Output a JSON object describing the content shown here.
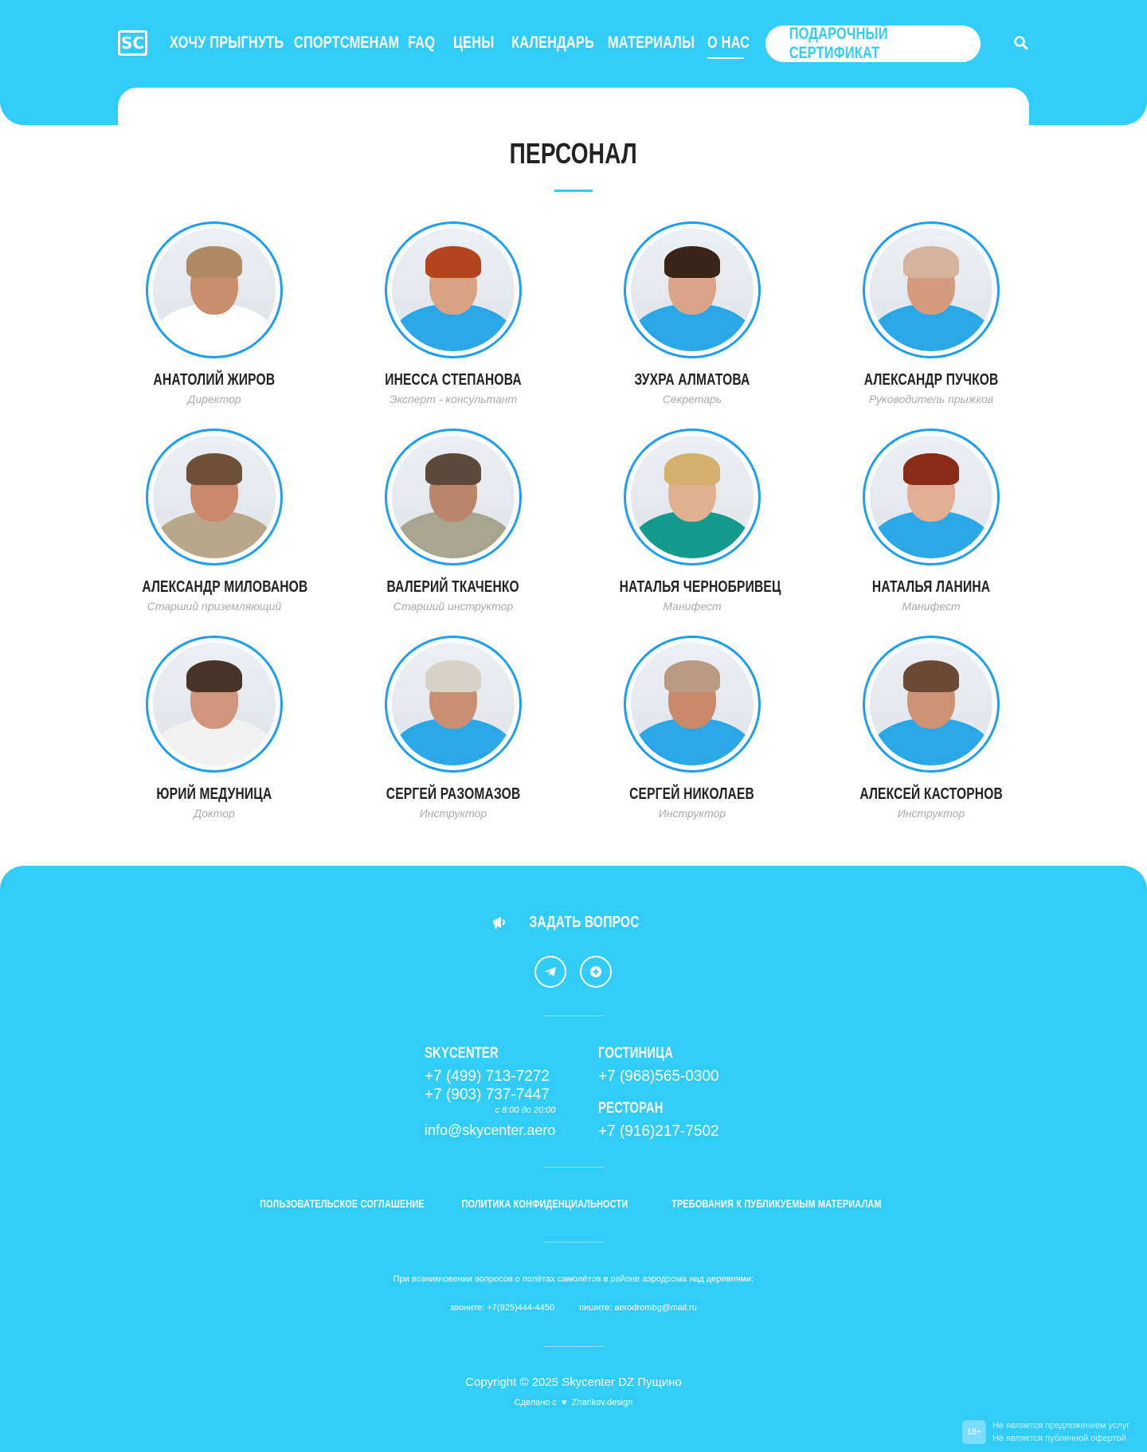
{
  "header": {
    "logo": "SC",
    "nav": [
      {
        "label": "ХОЧУ ПРЫГНУТЬ",
        "active": false
      },
      {
        "label": "СПОРТСМЕНАМ",
        "active": false
      },
      {
        "label": "FAQ",
        "active": false
      },
      {
        "label": "ЦЕНЫ",
        "active": false
      },
      {
        "label": "КАЛЕНДАРЬ",
        "active": false
      },
      {
        "label": "МАТЕРИАЛЫ",
        "active": false
      },
      {
        "label": "О НАС",
        "active": true
      }
    ],
    "gift_button": "ПОДАРОЧНЫЙ СЕРТИФИКАТ"
  },
  "main": {
    "title": "ПЕРСОНАЛ",
    "staff": [
      {
        "name": "АНАТОЛИЙ ЖИРОВ",
        "role": "Директор",
        "shirt": "#ffffff",
        "hair": "#b08a62",
        "skin": "#c98f6c"
      },
      {
        "name": "ИНЕССА СТЕПАНОВА",
        "role": "Эксперт - консультант",
        "shirt": "#2aa7e6",
        "hair": "#b3441e",
        "skin": "#d8a284"
      },
      {
        "name": "ЗУХРА АЛМАТОВА",
        "role": "Секретарь",
        "shirt": "#2aa7e6",
        "hair": "#3a2418",
        "skin": "#d9a488"
      },
      {
        "name": "АЛЕКСАНДР ПУЧКОВ",
        "role": "Руководитель прыжков",
        "shirt": "#2aa7e6",
        "hair": "#d6b49c",
        "skin": "#d49c7c"
      },
      {
        "name": "АЛЕКСАНДР МИЛОВАНОВ",
        "role": "Старший приземляющий",
        "shirt": "#b8a78a",
        "hair": "#6e5038",
        "skin": "#c9896a"
      },
      {
        "name": "ВАЛЕРИЙ ТКАЧЕНКО",
        "role": "Старший инструктор",
        "shirt": "#a8a58e",
        "hair": "#5e4a3a",
        "skin": "#b9866a"
      },
      {
        "name": "НАТАЛЬЯ ЧЕРНОБРИВЕЦ",
        "role": "Манифест",
        "shirt": "#159b8c",
        "hair": "#d4b06c",
        "skin": "#e0b091"
      },
      {
        "name": "НАТАЛЬЯ ЛАНИНА",
        "role": "Манифест",
        "shirt": "#2aa7e6",
        "hair": "#8a2b18",
        "skin": "#e2ae93"
      },
      {
        "name": "ЮРИЙ МЕДУНИЦА",
        "role": "Доктор",
        "shirt": "#f2f2f2",
        "hair": "#4a3428",
        "skin": "#cf957a"
      },
      {
        "name": "СЕРГЕЙ РАЗОМАЗОВ",
        "role": "Инструктор",
        "shirt": "#2aa7e6",
        "hair": "#d8d2c8",
        "skin": "#c98f72"
      },
      {
        "name": "СЕРГЕЙ НИКОЛАЕВ",
        "role": "Инструктор",
        "shirt": "#2aa7e6",
        "hair": "#b89a80",
        "skin": "#c98868"
      },
      {
        "name": "АЛЕКСЕЙ КАСТОРНОВ",
        "role": "Инструктор",
        "shirt": "#2aa7e6",
        "hair": "#6a4a32",
        "skin": "#cd9274"
      }
    ]
  },
  "footer": {
    "ask_button": "ЗАДАТЬ ВОПРОС",
    "social_icons": [
      "telegram-icon",
      "plus-circle-icon"
    ],
    "skycenter": {
      "heading": "SKYCENTER",
      "phone1": "+7 (499) 713-7272",
      "phone2": "+7 (903) 737-7447",
      "hours": "с 8:00 до 20:00",
      "email": "info@skycenter.aero"
    },
    "hotel": {
      "heading": "ГОСТИНИЦА",
      "phone": "+7 (968)565-0300"
    },
    "restaurant": {
      "heading": "РЕСТОРАН",
      "phone": "+7 (916)217-7502"
    },
    "legal_links": [
      "ПОЛЬЗОВАТЕЛЬСКОЕ СОГЛАШЕНИЕ",
      "ПОЛИТИКА КОНФИДЕНЦИАЛЬНОСТИ",
      "ТРЕБОВАНИЯ К ПУБЛИКУЕМЫМ МАТЕРИАЛАМ"
    ],
    "notice": "При возникновении вопросов о полётах самолётов в районе аэродрома над деревнями:",
    "notice_call": "звоните: +7(925)444-4450",
    "notice_write": "пишите: aerodrombg@mail.ru",
    "copyright": "Copyright © 2025 Skycenter DZ Пущино",
    "made_by_prefix": "Сделано с",
    "made_by_suffix": "Zharikov.design",
    "age_badge": "18+",
    "disclaimer_line1": "Не является предложением услуг.",
    "disclaimer_line2": "Не является публичной офертой"
  },
  "colors": {
    "accent": "#31cdf8",
    "avatar_ring": "#1e9ef0"
  }
}
